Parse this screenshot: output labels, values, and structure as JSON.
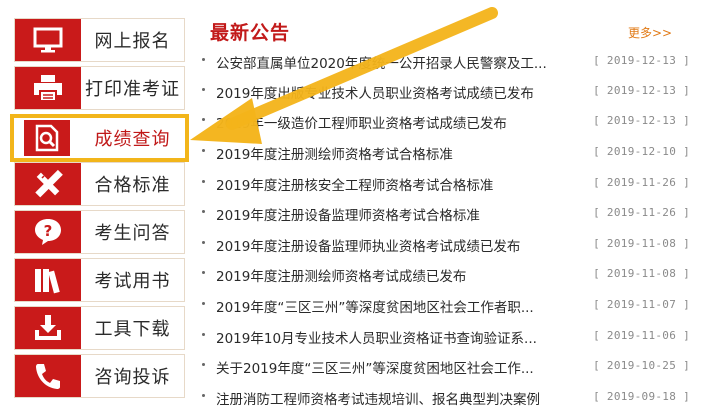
{
  "sidebar": {
    "items": [
      {
        "label": "网上报名",
        "icon": "monitor-icon"
      },
      {
        "label": "打印准考证",
        "icon": "printer-icon"
      },
      {
        "label": "成绩查询",
        "icon": "search-document-icon",
        "active": true
      },
      {
        "label": "合格标准",
        "icon": "ruler-pencil-icon"
      },
      {
        "label": "考生问答",
        "icon": "question-bubble-icon"
      },
      {
        "label": "考试用书",
        "icon": "books-icon"
      },
      {
        "label": "工具下载",
        "icon": "download-tray-icon"
      },
      {
        "label": "咨询投诉",
        "icon": "phone-icon"
      }
    ]
  },
  "header": {
    "title": "最新公告",
    "more_label": "更多>>"
  },
  "news": [
    {
      "title": "公安部直属单位2020年度统一公开招录人民警察及工...",
      "date": "[ 2019-12-13 ]"
    },
    {
      "title": "2019年度出版专业技术人员职业资格考试成绩已发布",
      "date": "[ 2019-12-13 ]"
    },
    {
      "title": "2019年一级造价工程师职业资格考试成绩已发布",
      "date": "[ 2019-12-13 ]"
    },
    {
      "title": "2019年度注册测绘师资格考试合格标准",
      "date": "[ 2019-12-10 ]"
    },
    {
      "title": "2019年度注册核安全工程师资格考试合格标准",
      "date": "[ 2019-11-26 ]"
    },
    {
      "title": "2019年度注册设备监理师资格考试合格标准",
      "date": "[ 2019-11-26 ]"
    },
    {
      "title": "2019年度注册设备监理师执业资格考试成绩已发布",
      "date": "[ 2019-11-08 ]"
    },
    {
      "title": "2019年度注册测绘师资格考试成绩已发布",
      "date": "[ 2019-11-08 ]"
    },
    {
      "title": "2019年度“三区三州”等深度贫困地区社会工作者职...",
      "date": "[ 2019-11-07 ]"
    },
    {
      "title": "2019年10月专业技术人员职业资格证书查询验证系...",
      "date": "[ 2019-11-06 ]"
    },
    {
      "title": "关于2019年度“三区三州”等深度贫困地区社会工作...",
      "date": "[ 2019-10-25 ]"
    },
    {
      "title": "注册消防工程师资格考试违规培训、报名典型判决案例",
      "date": "[ 2019-09-18 ]"
    }
  ],
  "colors": {
    "brand_red": "#c91a1a",
    "highlight": "#f2b51a",
    "more": "#e17a16"
  }
}
